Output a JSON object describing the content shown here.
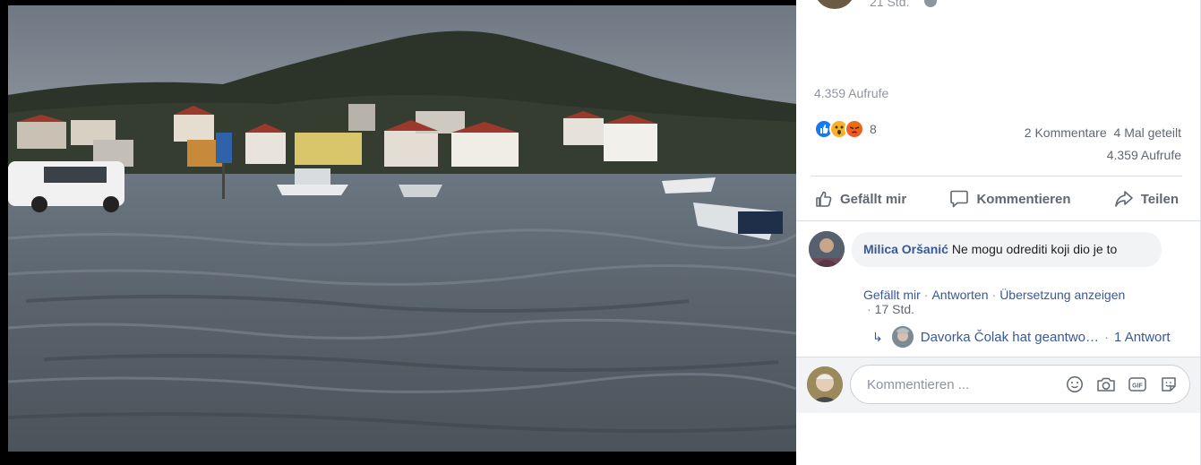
{
  "post": {
    "time": "21 Std.",
    "views_label": "4.359 Aufrufe"
  },
  "reactions": {
    "count": "8",
    "types": [
      "like-reaction-icon",
      "wow-reaction-icon",
      "angry-reaction-icon"
    ]
  },
  "stats": {
    "comments": "2 Kommentare",
    "shares": "4 Mal geteilt",
    "views": "4.359 Aufrufe"
  },
  "actions": {
    "like": "Gefällt mir",
    "comment": "Kommentieren",
    "share": "Teilen"
  },
  "comment": {
    "author": "Milica Oršanić",
    "text": "Ne mogu odrediti koji dio je to",
    "like": "Gefällt mir",
    "reply": "Antworten",
    "translate": "Übersetzung anzeigen",
    "time": "17 Std."
  },
  "reply_preview": {
    "text": "Davorka Čolak hat geantwo…",
    "count": "1 Antwort"
  },
  "composer": {
    "placeholder": "Kommentieren ..."
  },
  "colors": {
    "link": "#385898",
    "like_blue": "#1877f2",
    "muted": "#606770"
  }
}
